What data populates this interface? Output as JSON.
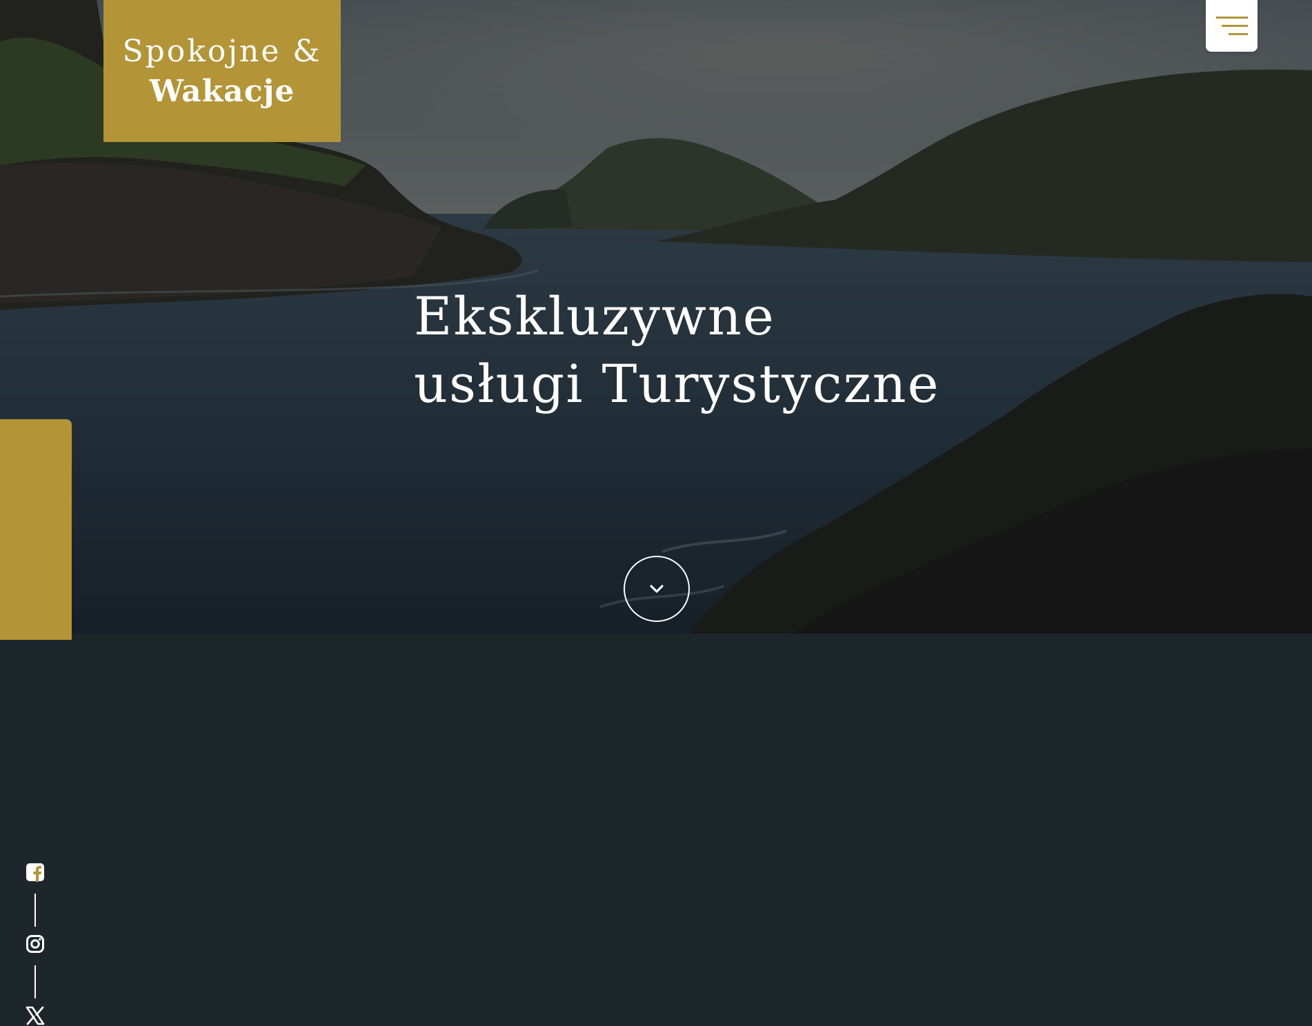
{
  "brand": {
    "line1": "Spokojne &",
    "line2": "Wakacje",
    "color": "#b39436"
  },
  "header": {
    "menu_icon": "hamburger-menu-icon"
  },
  "hero": {
    "headline_line1": "Ekskluzywne",
    "headline_line2": "usługi Turystyczne",
    "background": "coastal-seascape-photo",
    "scroll_icon": "chevron-down-icon"
  },
  "social": {
    "links": [
      {
        "icon": "facebook-icon"
      },
      {
        "icon": "instagram-icon"
      },
      {
        "icon": "x-twitter-icon"
      }
    ]
  }
}
